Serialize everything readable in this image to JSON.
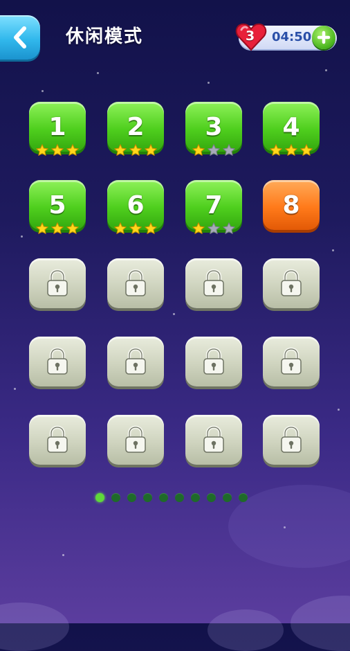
{
  "header": {
    "title": "休闲模式",
    "lives": "3",
    "timer": "04:50",
    "colors": {
      "back": "#31b8ec",
      "heart": "#e8203a",
      "timer_text": "#2a4fa8",
      "plus": "#48b41c"
    }
  },
  "levels": [
    {
      "label": "1",
      "state": "completed",
      "stars": 3
    },
    {
      "label": "2",
      "state": "completed",
      "stars": 3
    },
    {
      "label": "3",
      "state": "completed",
      "stars": 1
    },
    {
      "label": "4",
      "state": "completed",
      "stars": 3
    },
    {
      "label": "5",
      "state": "completed",
      "stars": 3
    },
    {
      "label": "6",
      "state": "completed",
      "stars": 3
    },
    {
      "label": "7",
      "state": "completed",
      "stars": 1
    },
    {
      "label": "8",
      "state": "current",
      "stars": 0
    },
    {
      "label": "",
      "state": "locked",
      "stars": 0
    },
    {
      "label": "",
      "state": "locked",
      "stars": 0
    },
    {
      "label": "",
      "state": "locked",
      "stars": 0
    },
    {
      "label": "",
      "state": "locked",
      "stars": 0
    },
    {
      "label": "",
      "state": "locked",
      "stars": 0
    },
    {
      "label": "",
      "state": "locked",
      "stars": 0
    },
    {
      "label": "",
      "state": "locked",
      "stars": 0
    },
    {
      "label": "",
      "state": "locked",
      "stars": 0
    },
    {
      "label": "",
      "state": "locked",
      "stars": 0
    },
    {
      "label": "",
      "state": "locked",
      "stars": 0
    },
    {
      "label": "",
      "state": "locked",
      "stars": 0
    },
    {
      "label": "",
      "state": "locked",
      "stars": 0
    }
  ],
  "pagination": {
    "total_pages": 10,
    "current_page": 1
  }
}
